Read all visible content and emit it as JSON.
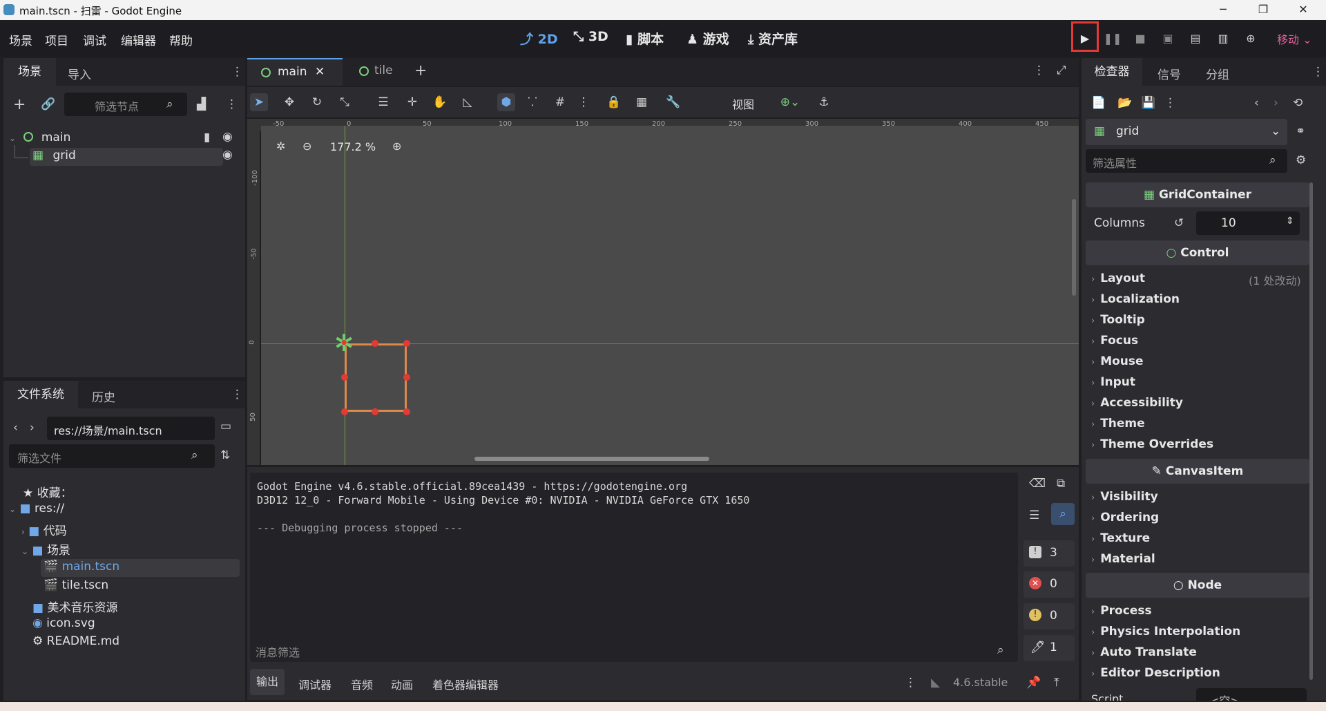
{
  "window": {
    "title": "main.tscn - 扫雷 - Godot Engine",
    "minimize": "─",
    "maximize": "❐",
    "close": "✕"
  },
  "menu": [
    "场景",
    "项目",
    "调试",
    "编辑器",
    "帮助"
  ],
  "main_screens": [
    "2D",
    "3D",
    "脚本",
    "游戏",
    "资产库"
  ],
  "renderer": "移动",
  "scene_dock": {
    "tabs": [
      "场景",
      "导入"
    ],
    "filter_placeholder": "筛选节点",
    "nodes": [
      {
        "name": "main"
      },
      {
        "name": "grid"
      }
    ]
  },
  "filesystem_dock": {
    "tabs": [
      "文件系统",
      "历史"
    ],
    "path": "res://场景/main.tscn",
    "filter_placeholder": "筛选文件",
    "favorites": "收藏：",
    "items": [
      {
        "name": "res://"
      },
      {
        "name": "代码"
      },
      {
        "name": "场景"
      },
      {
        "name": "main.tscn"
      },
      {
        "name": "tile.tscn"
      },
      {
        "name": "美术音乐资源"
      },
      {
        "name": "icon.svg"
      },
      {
        "name": "README.md"
      }
    ]
  },
  "editor_tabs": [
    "main",
    "tile"
  ],
  "toolbar": {
    "view_label": "视图"
  },
  "viewport": {
    "zoom": "177.2 %",
    "ruler_h": [
      "-50",
      "0",
      "50",
      "100",
      "150",
      "200",
      "250",
      "300",
      "350",
      "400",
      "450"
    ],
    "ruler_v": [
      "-100",
      "-50",
      "0",
      "50"
    ]
  },
  "output": {
    "lines": [
      "Godot Engine v4.6.stable.official.89cea1439 - https://godotengine.org",
      "D3D12 12_0 - Forward Mobile - Using Device #0: NVIDIA - NVIDIA GeForce GTX 1650",
      "",
      "--- Debugging process stopped ---"
    ],
    "filter_placeholder": "消息筛选",
    "counts": {
      "messages": "3",
      "errors": "0",
      "warnings": "0",
      "editor": "1"
    }
  },
  "bottom_tabs": [
    "输出",
    "调试器",
    "音频",
    "动画",
    "着色器编辑器"
  ],
  "version": "4.6.stable",
  "inspector": {
    "tabs": [
      "检查器",
      "信号",
      "分组"
    ],
    "node_name": "grid",
    "filter_placeholder": "筛选属性",
    "class_grid": "GridContainer",
    "columns_label": "Columns",
    "columns_value": "10",
    "class_control": "Control",
    "control_props": [
      "Layout",
      "Localization",
      "Tooltip",
      "Focus",
      "Mouse",
      "Input",
      "Accessibility",
      "Theme",
      "Theme Overrides"
    ],
    "layout_note": "(1 处改动)",
    "class_canvas": "CanvasItem",
    "canvas_props": [
      "Visibility",
      "Ordering",
      "Texture",
      "Material"
    ],
    "class_node": "Node",
    "node_props": [
      "Process",
      "Physics Interpolation",
      "Auto Translate",
      "Editor Description"
    ],
    "script_label": "Script",
    "script_value": "<空>"
  },
  "colors": {
    "accent": "#5fa2ea",
    "play_highlight": "#e53935",
    "renderer": "#e0609a"
  }
}
